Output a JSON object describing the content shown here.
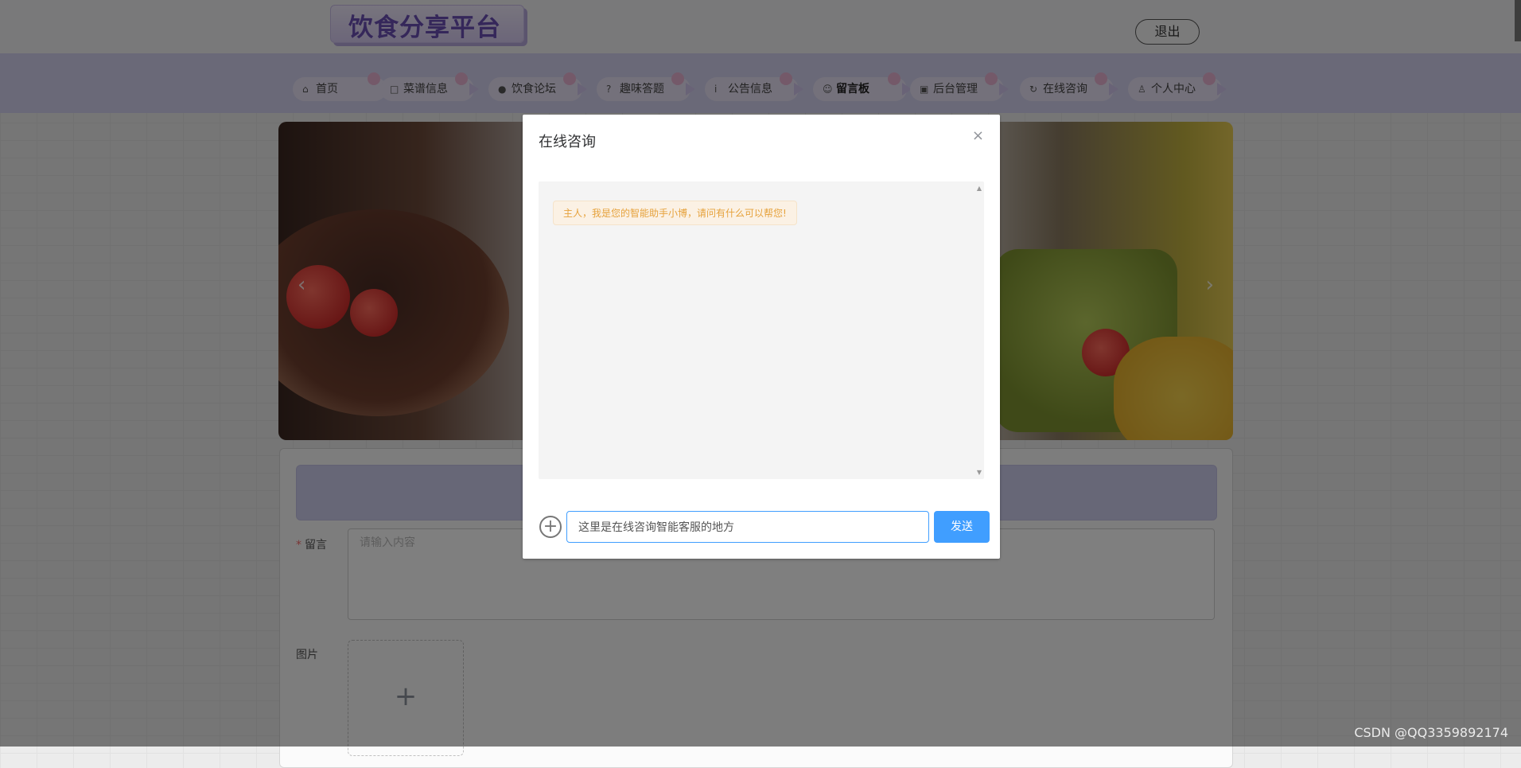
{
  "header": {
    "logo_text": "饮食分享平台",
    "logout_label": "退出"
  },
  "nav": {
    "items": [
      {
        "label": "首页",
        "icon": "⌂"
      },
      {
        "label": "菜谱信息",
        "icon": "□"
      },
      {
        "label": "饮食论坛",
        "icon": "●"
      },
      {
        "label": "趣味答题",
        "icon": "?"
      },
      {
        "label": "公告信息",
        "icon": "i"
      },
      {
        "label": "留言板",
        "icon": "☺"
      },
      {
        "label": "后台管理",
        "icon": "▣"
      },
      {
        "label": "在线咨询",
        "icon": "↻"
      },
      {
        "label": "个人中心",
        "icon": "♙"
      }
    ]
  },
  "banner": {
    "prev": "‹",
    "next": "›"
  },
  "form": {
    "message_label": "留言",
    "message_required": "*",
    "message_placeholder": "请输入内容",
    "image_label": "图片",
    "upload_icon": "+"
  },
  "dialog": {
    "title": "在线咨询",
    "close": "×",
    "bot_message": "主人，我是您的智能助手小博，请问有什么可以帮您!",
    "input_value": "这里是在线咨询智能客服的地方",
    "send_label": "发送",
    "add_icon": "+"
  },
  "watermark": "CSDN @QQ3359892174",
  "colors": {
    "primary": "#409eff",
    "nav_bg": "#d4d3f0",
    "bubble_text": "#e6a23c"
  }
}
